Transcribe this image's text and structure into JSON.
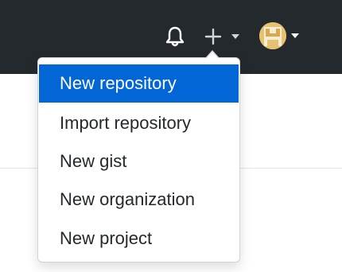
{
  "header": {
    "icons": {
      "notifications": "bell-icon",
      "create": "plus-icon",
      "create_caret": "caret-down-icon",
      "avatar": "user-avatar",
      "avatar_caret": "caret-down-icon"
    },
    "background_color": "#24292e"
  },
  "dropdown": {
    "items": [
      {
        "label": "New repository",
        "active": true
      },
      {
        "label": "Import repository",
        "active": false
      },
      {
        "label": "New gist",
        "active": false
      },
      {
        "label": "New organization",
        "active": false
      },
      {
        "label": "New project",
        "active": false
      }
    ],
    "active_color": "#0366d6"
  }
}
